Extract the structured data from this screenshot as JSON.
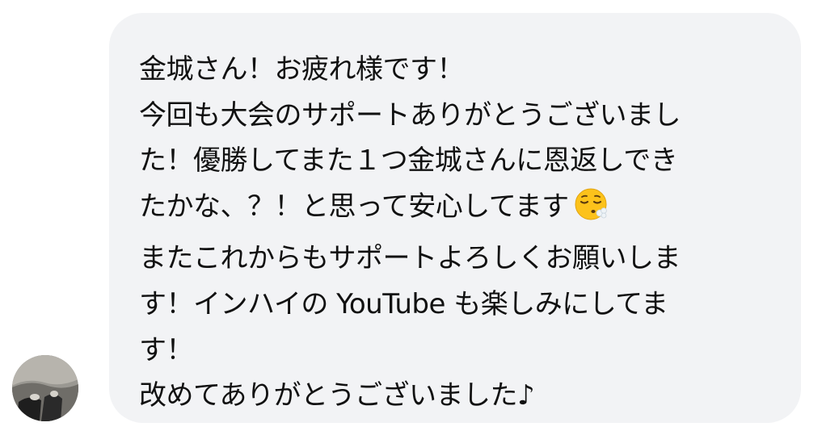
{
  "message": {
    "lines": [
      "金城さん！お疲れ様です！",
      "今回も大会のサポートありがとうございまし",
      "た！優勝してまた１つ金城さんに恩返しでき",
      "たかな、？！と思って安心してます",
      "またこれからもサポートよろしくお願いしま",
      "す！インハイの YouTube も楽しみにしてま",
      "す！",
      "改めてありがとうございました♪"
    ],
    "emoji": "face-exhaling"
  },
  "colors": {
    "bubble": "#f2f3f5",
    "text": "#111111",
    "emoji_face": "#fcc21b"
  }
}
